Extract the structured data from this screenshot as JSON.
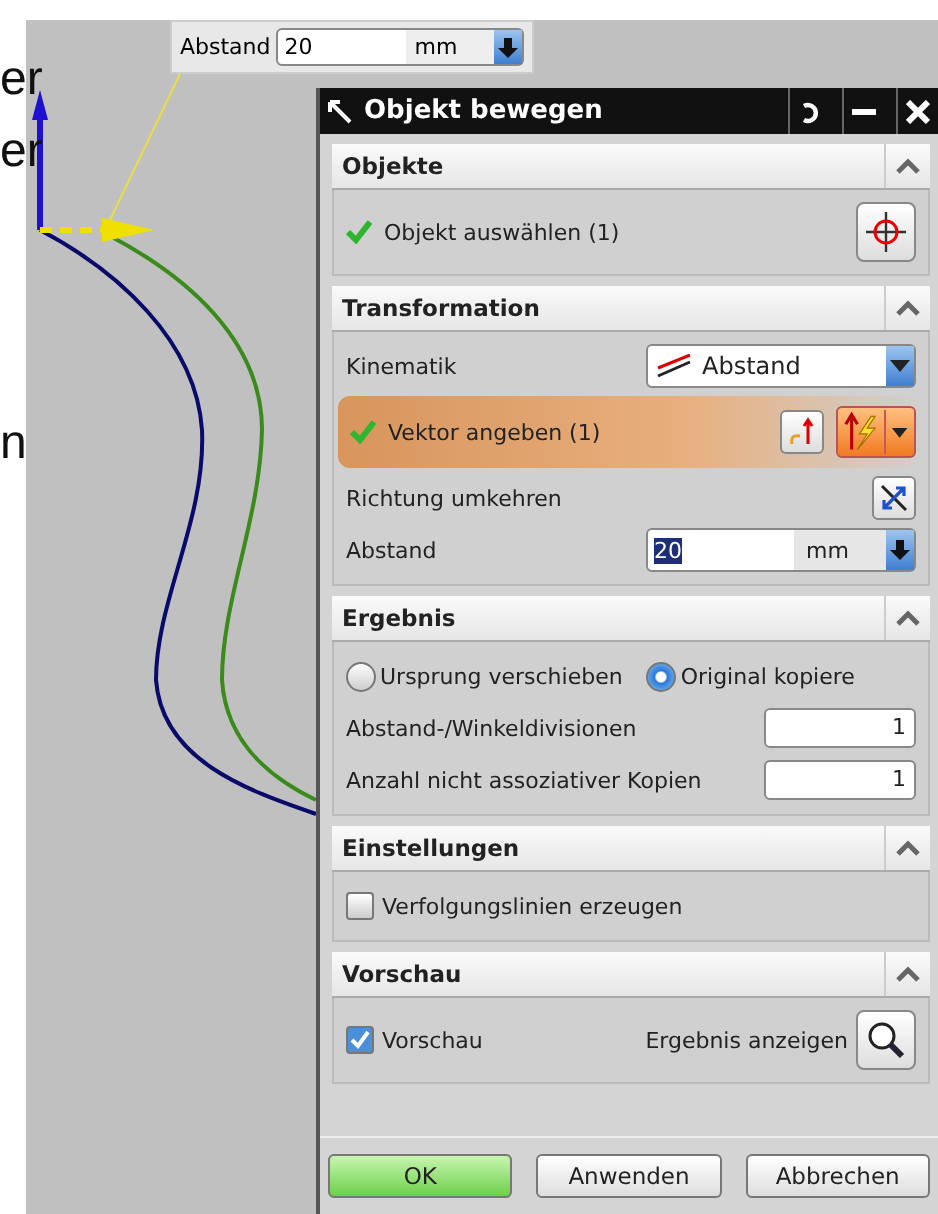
{
  "slide_fragments": [
    "er",
    "er",
    "n"
  ],
  "distance_popup": {
    "label": "Abstand",
    "value": "20",
    "unit": "mm"
  },
  "dialog": {
    "title": "Objekt bewegen",
    "sections": [
      {
        "title": "Objekte",
        "expanded": true,
        "rows": [
          {
            "kind": "object_picker",
            "label": "Objekt auswählen (1)",
            "done": true,
            "active": false
          }
        ]
      },
      {
        "title": "Transformation",
        "expanded": true,
        "rows": [
          {
            "kind": "dropdown",
            "label": "Kinematik",
            "value": "Abstand"
          },
          {
            "kind": "vector_picker",
            "label": "Vektor angeben (1)",
            "done": true,
            "active": true
          },
          {
            "kind": "reverse",
            "label": "Richtung umkehren"
          },
          {
            "kind": "unit_field",
            "label": "Abstand",
            "value": "20",
            "unit": "mm"
          }
        ]
      },
      {
        "title": "Ergebnis",
        "expanded": true,
        "rows": [
          {
            "kind": "radios",
            "options": [
              {
                "label": "Ursprung verschieben",
                "selected": false
              },
              {
                "label": "Original kopiere",
                "selected": true
              }
            ]
          },
          {
            "kind": "number",
            "label": "Abstand-/Winkeldivisionen",
            "value": "1"
          },
          {
            "kind": "number",
            "label": "Anzahl nicht assoziativer Kopien",
            "value": "1"
          }
        ]
      },
      {
        "title": "Einstellungen",
        "expanded": true,
        "rows": [
          {
            "kind": "checkbox",
            "label": "Verfolgungslinien erzeugen",
            "checked": false
          }
        ]
      },
      {
        "title": "Vorschau",
        "expanded": true,
        "rows": [
          {
            "kind": "preview",
            "label": "Vorschau",
            "checked": true,
            "action": "Ergebnis anzeigen"
          }
        ]
      }
    ],
    "buttons": [
      {
        "label": "OK",
        "default": true
      },
      {
        "label": "Anwenden",
        "default": false
      },
      {
        "label": "Abbrechen",
        "default": false
      }
    ]
  }
}
